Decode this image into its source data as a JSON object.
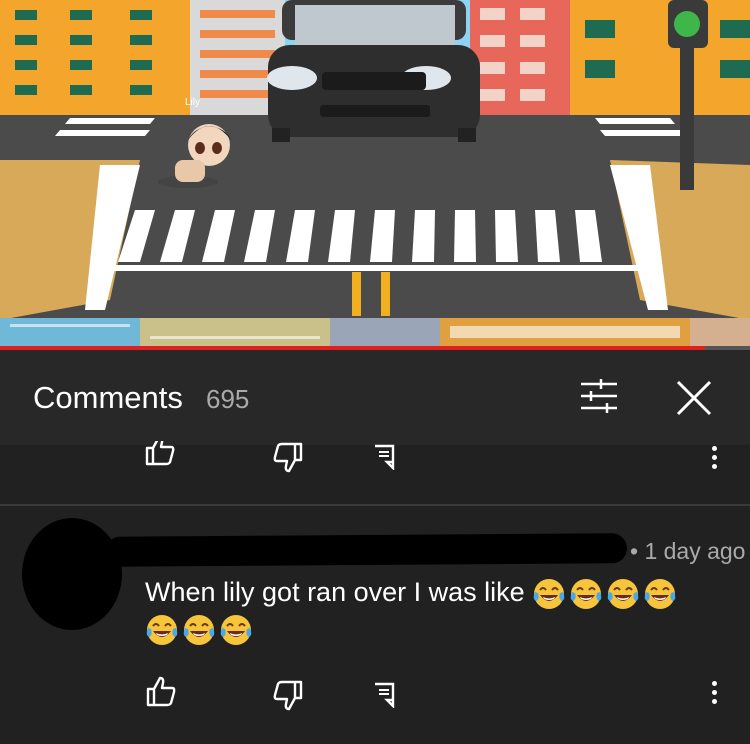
{
  "video": {
    "character_name": "Lily",
    "progress_fraction": 0.94
  },
  "comments_header": {
    "title": "Comments",
    "count": "695",
    "filter_icon": "sort-sliders-icon",
    "close_icon": "close-icon"
  },
  "previous_comment_actions": {
    "like_icon": "thumbs-up-icon",
    "dislike_icon": "thumbs-down-icon",
    "reply_icon": "reply-icon",
    "more_icon": "more-vertical-icon"
  },
  "comment": {
    "timestamp": "• 1 day ago",
    "text": "When lily got ran over I was like",
    "emoji": "face-with-tears-of-joy",
    "emoji_count": 7,
    "like_icon": "thumbs-up-icon",
    "dislike_icon": "thumbs-down-icon",
    "reply_icon": "reply-icon",
    "more_icon": "more-vertical-icon"
  },
  "colors": {
    "background": "#212121",
    "header_background": "#282828",
    "progress": "#e02020",
    "secondary_text": "#aaaaaa"
  }
}
